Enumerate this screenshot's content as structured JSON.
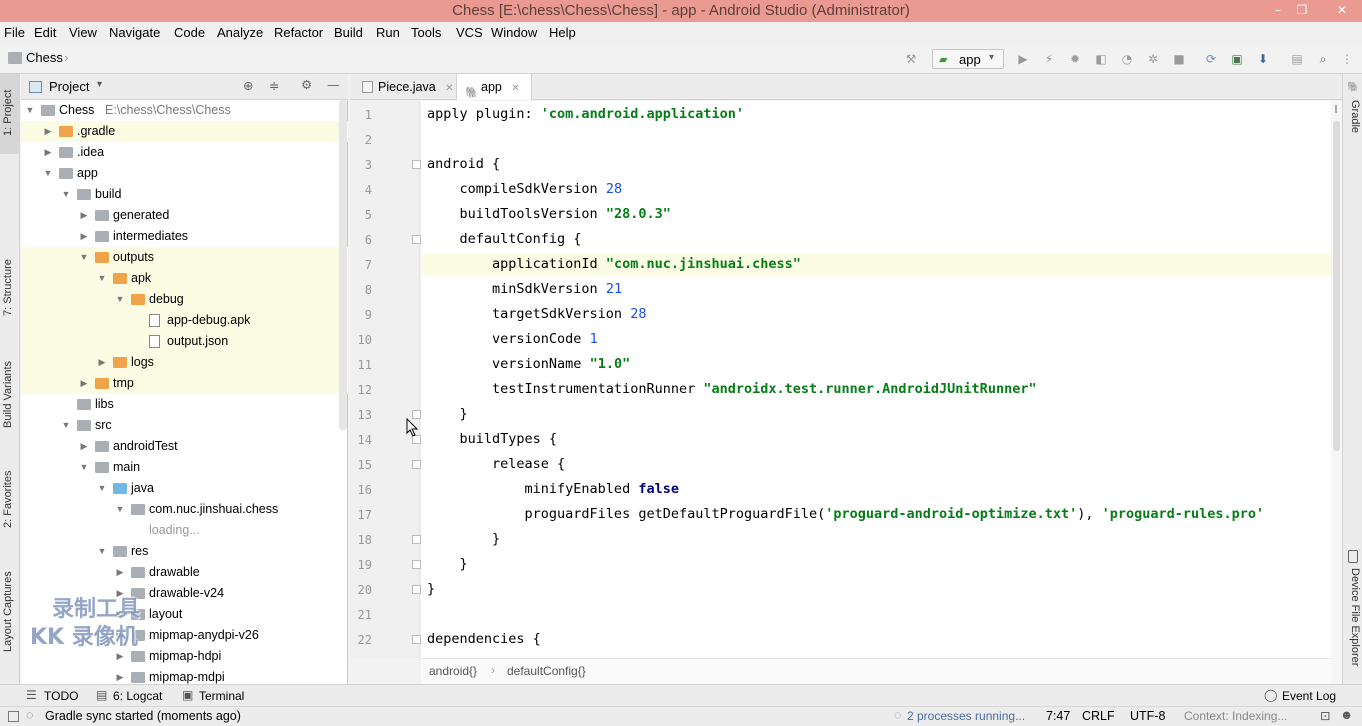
{
  "window": {
    "title": "Chess [E:\\chess\\Chess\\Chess] - app - Android Studio (Administrator)",
    "minimize": "–",
    "maximize": "❐",
    "close": "✕"
  },
  "menu": [
    "File",
    "Edit",
    "View",
    "Navigate",
    "Code",
    "Analyze",
    "Refactor",
    "Build",
    "Run",
    "Tools",
    "VCS",
    "Window",
    "Help"
  ],
  "nav": {
    "project_name": "Chess",
    "run_config": "app"
  },
  "left_strip": [
    "1: Project",
    "7: Structure",
    "Build Variants",
    "2: Favorites",
    "Layout Captures"
  ],
  "right_strip": [
    "Gradle",
    "Device File Explorer"
  ],
  "project_panel": {
    "header": "Project",
    "tree": [
      {
        "label": "Chess",
        "sub": "E:\\chess\\Chess\\Chess",
        "depth": 0,
        "arrow": "open",
        "icon": "folder-gray"
      },
      {
        "label": ".gradle",
        "depth": 1,
        "arrow": "closed",
        "icon": "folder-orange",
        "hl": true
      },
      {
        "label": ".idea",
        "depth": 1,
        "arrow": "closed",
        "icon": "folder-gray"
      },
      {
        "label": "app",
        "depth": 1,
        "arrow": "open",
        "icon": "folder-gray"
      },
      {
        "label": "build",
        "depth": 2,
        "arrow": "open",
        "icon": "folder-gray"
      },
      {
        "label": "generated",
        "depth": 3,
        "arrow": "closed",
        "icon": "folder-gray"
      },
      {
        "label": "intermediates",
        "depth": 3,
        "arrow": "closed",
        "icon": "folder-gray"
      },
      {
        "label": "outputs",
        "depth": 3,
        "arrow": "open",
        "icon": "folder-orange",
        "hl": true
      },
      {
        "label": "apk",
        "depth": 4,
        "arrow": "open",
        "icon": "folder-orange",
        "hl": true
      },
      {
        "label": "debug",
        "depth": 5,
        "arrow": "open",
        "icon": "folder-orange",
        "hl": true
      },
      {
        "label": "app-debug.apk",
        "depth": 6,
        "arrow": "none",
        "icon": "file",
        "hl": true
      },
      {
        "label": "output.json",
        "depth": 6,
        "arrow": "none",
        "icon": "file",
        "hl": true
      },
      {
        "label": "logs",
        "depth": 4,
        "arrow": "closed",
        "icon": "folder-orange",
        "hl": true
      },
      {
        "label": "tmp",
        "depth": 3,
        "arrow": "closed",
        "icon": "folder-orange",
        "hl": true
      },
      {
        "label": "libs",
        "depth": 2,
        "arrow": "none",
        "icon": "folder-gray"
      },
      {
        "label": "src",
        "depth": 2,
        "arrow": "open",
        "icon": "folder-gray"
      },
      {
        "label": "androidTest",
        "depth": 3,
        "arrow": "closed",
        "icon": "folder-gray"
      },
      {
        "label": "main",
        "depth": 3,
        "arrow": "open",
        "icon": "folder-gray"
      },
      {
        "label": "java",
        "depth": 4,
        "arrow": "open",
        "icon": "folder-blue"
      },
      {
        "label": "com.nuc.jinshuai.chess",
        "depth": 5,
        "arrow": "open",
        "icon": "folder-gray"
      },
      {
        "label": "loading...",
        "depth": 6,
        "arrow": "none",
        "icon": "none",
        "muted": true
      },
      {
        "label": "res",
        "depth": 4,
        "arrow": "open",
        "icon": "folder-gray"
      },
      {
        "label": "drawable",
        "depth": 5,
        "arrow": "closed",
        "icon": "folder-gray"
      },
      {
        "label": "drawable-v24",
        "depth": 5,
        "arrow": "closed",
        "icon": "folder-gray"
      },
      {
        "label": "layout",
        "depth": 5,
        "arrow": "closed",
        "icon": "folder-gray"
      },
      {
        "label": "mipmap-anydpi-v26",
        "depth": 5,
        "arrow": "closed",
        "icon": "folder-gray"
      },
      {
        "label": "mipmap-hdpi",
        "depth": 5,
        "arrow": "closed",
        "icon": "folder-gray"
      },
      {
        "label": "mipmap-mdpi",
        "depth": 5,
        "arrow": "closed",
        "icon": "folder-gray"
      }
    ]
  },
  "tabs": [
    {
      "label": "Piece.java",
      "active": false
    },
    {
      "label": "app",
      "active": true
    }
  ],
  "code_lines": [
    [
      {
        "t": "apply plugin: "
      },
      {
        "t": "'com.android.application'",
        "c": "str"
      }
    ],
    [],
    [
      {
        "t": "android {"
      }
    ],
    [
      {
        "t": "    compileSdkVersion "
      },
      {
        "t": "28",
        "c": "num"
      }
    ],
    [
      {
        "t": "    buildToolsVersion "
      },
      {
        "t": "\"28.0.3\"",
        "c": "str"
      }
    ],
    [
      {
        "t": "    defaultConfig {"
      }
    ],
    [
      {
        "t": "        applicationId "
      },
      {
        "t": "\"com.nuc.jinshuai.chess\"",
        "c": "str"
      }
    ],
    [
      {
        "t": "        minSdkVersion "
      },
      {
        "t": "21",
        "c": "num"
      }
    ],
    [
      {
        "t": "        targetSdkVersion "
      },
      {
        "t": "28",
        "c": "num"
      }
    ],
    [
      {
        "t": "        versionCode "
      },
      {
        "t": "1",
        "c": "num"
      }
    ],
    [
      {
        "t": "        versionName "
      },
      {
        "t": "\"1.0\"",
        "c": "str"
      }
    ],
    [
      {
        "t": "        testInstrumentationRunner "
      },
      {
        "t": "\"androidx.test.runner.AndroidJUnitRunner\"",
        "c": "str"
      }
    ],
    [
      {
        "t": "    }"
      }
    ],
    [
      {
        "t": "    buildTypes {"
      }
    ],
    [
      {
        "t": "        release {"
      }
    ],
    [
      {
        "t": "            minifyEnabled "
      },
      {
        "t": "false",
        "c": "kw"
      }
    ],
    [
      {
        "t": "            proguardFiles getDefaultProguardFile("
      },
      {
        "t": "'proguard-android-optimize.txt'",
        "c": "str"
      },
      {
        "t": "), "
      },
      {
        "t": "'proguard-rules.pro'",
        "c": "str"
      }
    ],
    [
      {
        "t": "        }"
      }
    ],
    [
      {
        "t": "    }"
      }
    ],
    [
      {
        "t": "}"
      }
    ],
    [],
    [
      {
        "t": "dependencies {"
      }
    ]
  ],
  "highlight_line": 7,
  "breadcrumb": [
    "android{}",
    "defaultConfig{}"
  ],
  "bottom_tabs": {
    "todo": "TODO",
    "logcat": "6: Logcat",
    "terminal": "Terminal",
    "event_log": "Event Log"
  },
  "status": {
    "message": "Gradle sync started (moments ago)",
    "processes": "2 processes running...",
    "position": "7:47",
    "line_sep": "CRLF",
    "encoding": "UTF-8",
    "context": "Context: Indexing..."
  },
  "watermark": {
    "line1": "录制工具",
    "line2": "KK 录像机"
  },
  "colors": {
    "title_bar": "#ea9a92",
    "string": "#067d17",
    "keyword": "#000080",
    "highlight": "#fcfbe4"
  }
}
